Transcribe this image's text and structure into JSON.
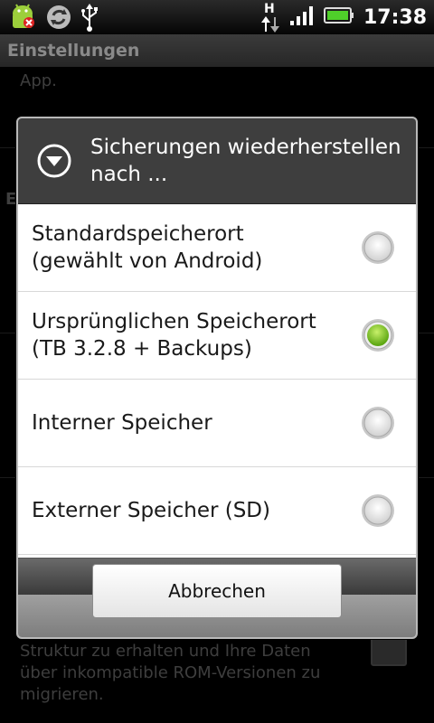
{
  "statusbar": {
    "time": "17:38",
    "network": "H"
  },
  "background": {
    "title": "Einstellungen",
    "app_fragment": "App.",
    "section_fragment": "E",
    "description": [
      "Struktur zu erhalten und Ihre Daten",
      "über inkompatible ROM-Versionen zu",
      "migrieren."
    ]
  },
  "dialog": {
    "title": "Sicherungen wiederherstellen nach ...",
    "options": [
      {
        "label": "Standardspeicherort (gewählt von Android)",
        "selected": false
      },
      {
        "label": "Ursprünglichen Speicherort (TB 3.2.8 + Backups)",
        "selected": true
      },
      {
        "label": "Interner Speicher",
        "selected": false
      },
      {
        "label": "Externer Speicher (SD)",
        "selected": false
      }
    ],
    "cancel_label": "Abbrechen"
  },
  "colors": {
    "radio_selected": "#7cc51a",
    "header_bg": "#3e3e3e"
  }
}
